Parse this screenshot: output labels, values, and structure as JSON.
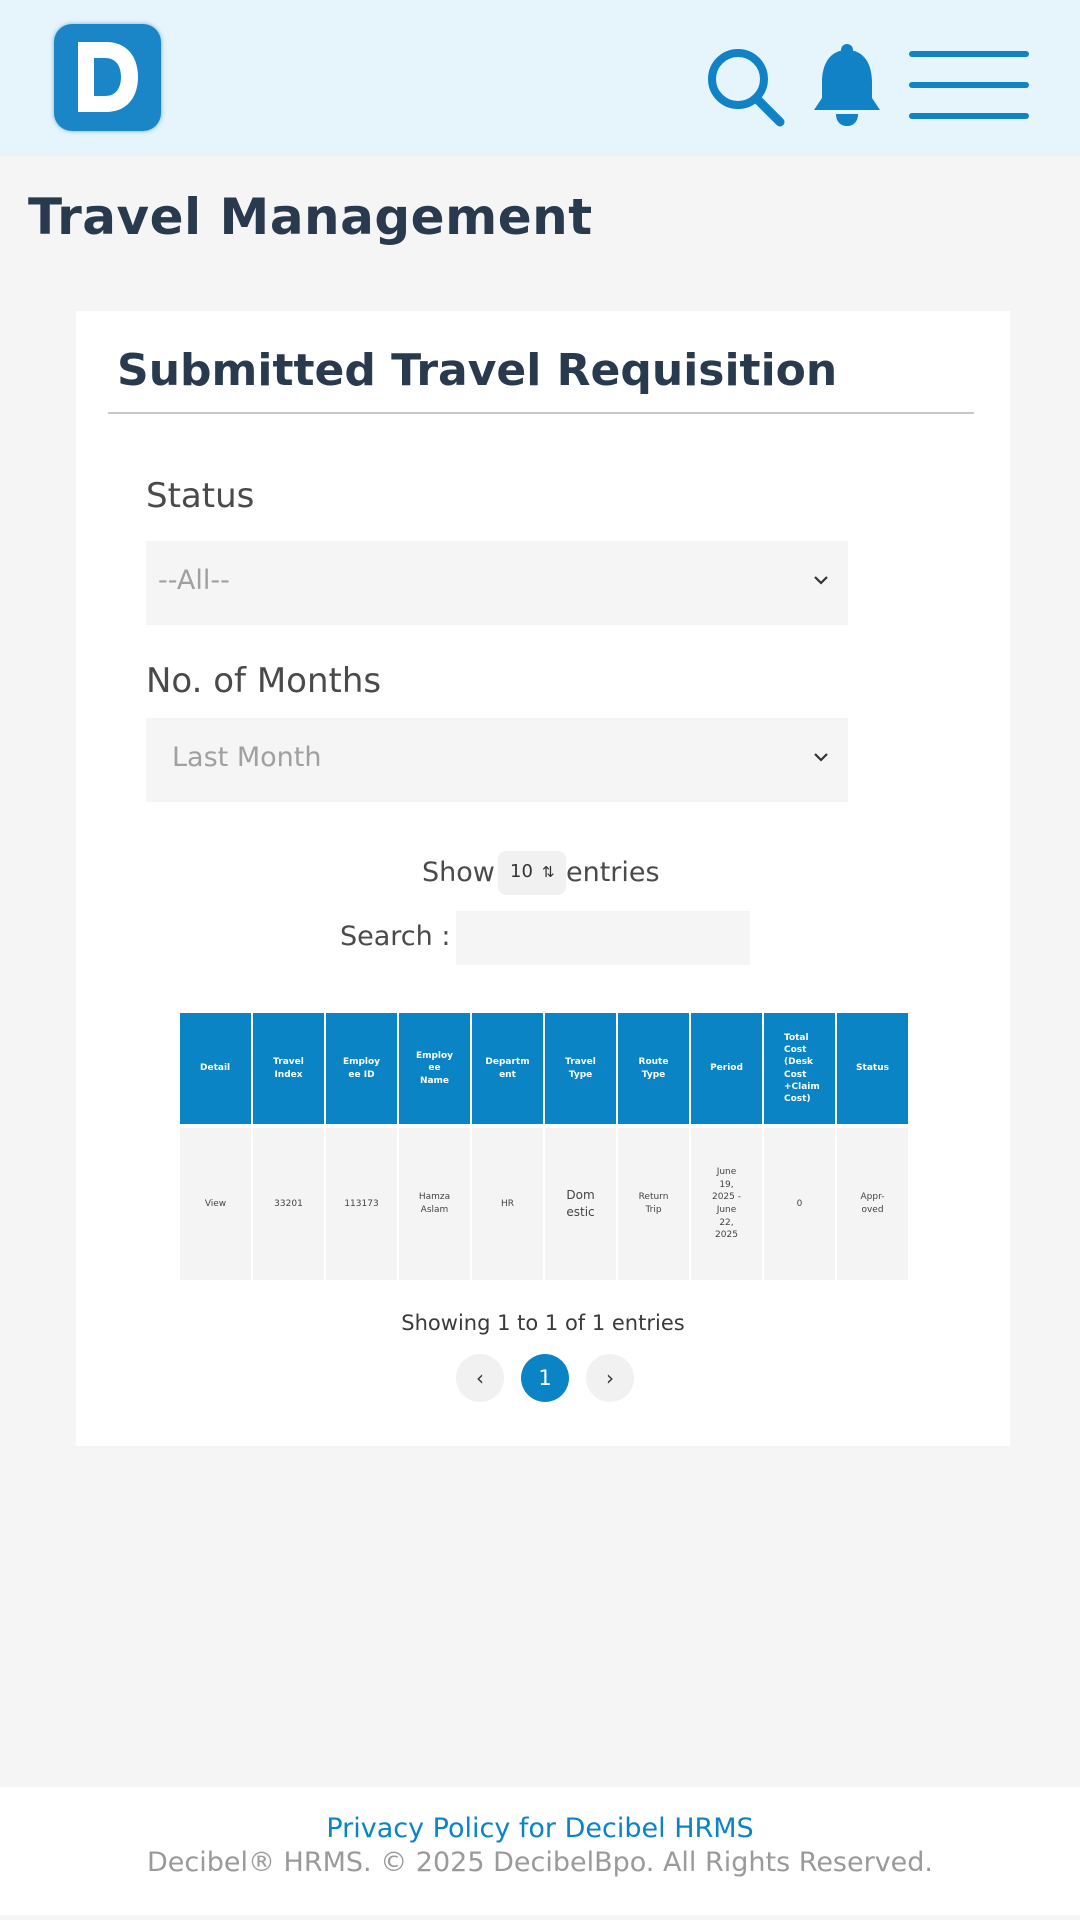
{
  "header": {
    "logo_letter": "D",
    "icons": [
      "search-icon",
      "bell-icon",
      "hamburger-menu-icon"
    ],
    "brand_color": "#1a86c7"
  },
  "page": {
    "title": "Travel Management"
  },
  "card": {
    "title": "Submitted Travel Requisition",
    "status": {
      "label": "Status",
      "value": "--All--"
    },
    "months": {
      "label": "No. of Months",
      "value": "Last Month"
    },
    "length": {
      "show": "Show",
      "value": "10",
      "entries": "entries"
    },
    "search": {
      "label": "Search :",
      "value": ""
    }
  },
  "table": {
    "headers": [
      "Detail",
      "Travel Index",
      "Employee ID",
      "Employee Name",
      "Department",
      "Travel Type",
      "Route Type",
      "Period",
      "Total Cost (Desk Cost +Claim Cost)",
      "Status"
    ],
    "header_display": [
      "Detail",
      "Travel\nIndex",
      "Employ\nee ID",
      "Employ\nee\nName",
      "Departm\nent",
      "Travel\nType",
      "Route\nType",
      "Period",
      "Total\nCost\n(Desk\nCost\n+Claim\nCost)",
      "Status"
    ],
    "rows": [
      [
        "View",
        "33201",
        "113173",
        "Hamza Aslam",
        "HR",
        "Domestic",
        "Return Trip",
        "June 19, 2025 - June 22, 2025",
        "0",
        "Approved"
      ]
    ],
    "row_display": [
      [
        "View",
        "33201",
        "113173",
        "Hamza\nAslam",
        "HR",
        "Dom\nestic",
        "Return\nTrip",
        "June\n19,\n2025 -\nJune\n22,\n2025",
        "0",
        "Appr-\noved"
      ]
    ],
    "header_color": "#0a84c4"
  },
  "pagination": {
    "info": "Showing 1 to 1 of 1 entries",
    "prev": "‹",
    "current": "1",
    "next": "›"
  },
  "footer": {
    "link": "Privacy Policy for Decibel HRMS",
    "copyright": "Decibel® HRMS. © 2025 DecibelBpo. All Rights Reserved."
  }
}
